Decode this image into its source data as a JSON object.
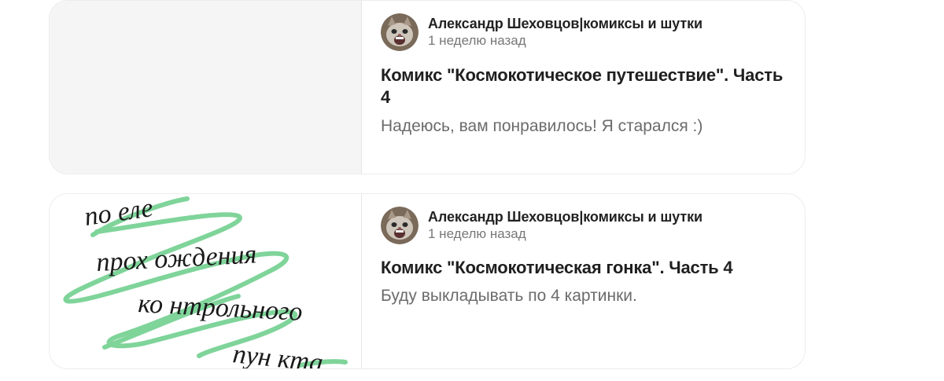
{
  "feed": {
    "cards": [
      {
        "author": "Александр Шеховцов|комиксы и шутки",
        "time": "1 неделю назад",
        "title": "Комикс \"Космокотическое путешествие\". Часть 4",
        "snippet": "Надеюсь, вам понравилось! Я старался :)"
      },
      {
        "author": "Александр Шеховцов|комиксы и шутки",
        "time": "1 неделю назад",
        "title": "Комикс \"Космокотическая гонка\". Часть 4",
        "snippet": "Буду выкладывать по 4 картинки.",
        "thumbnail_text": "после прохождения контрольного пункта"
      }
    ]
  },
  "colors": {
    "highlight_green": "#7fd49a",
    "card_border": "#ececec",
    "placeholder_bg": "#f5f5f5"
  }
}
